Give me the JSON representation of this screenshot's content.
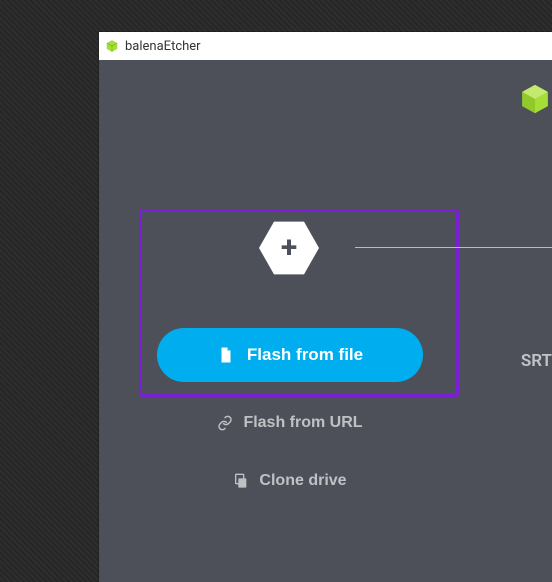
{
  "window": {
    "title": "balenaEtcher"
  },
  "step1": {
    "primary_label": "Flash from file",
    "url_label": "Flash from URL",
    "clone_label": "Clone drive"
  },
  "right_text": "SRT",
  "icons": {
    "app": "cube-icon",
    "logo": "cube-icon",
    "plus": "plus-icon",
    "file": "file-icon",
    "link": "link-icon",
    "copy": "copy-icon"
  },
  "colors": {
    "accent": "#00aeef",
    "bg": "#4d5058",
    "highlight": "#7b1fd6",
    "brand": "#a5de37"
  }
}
